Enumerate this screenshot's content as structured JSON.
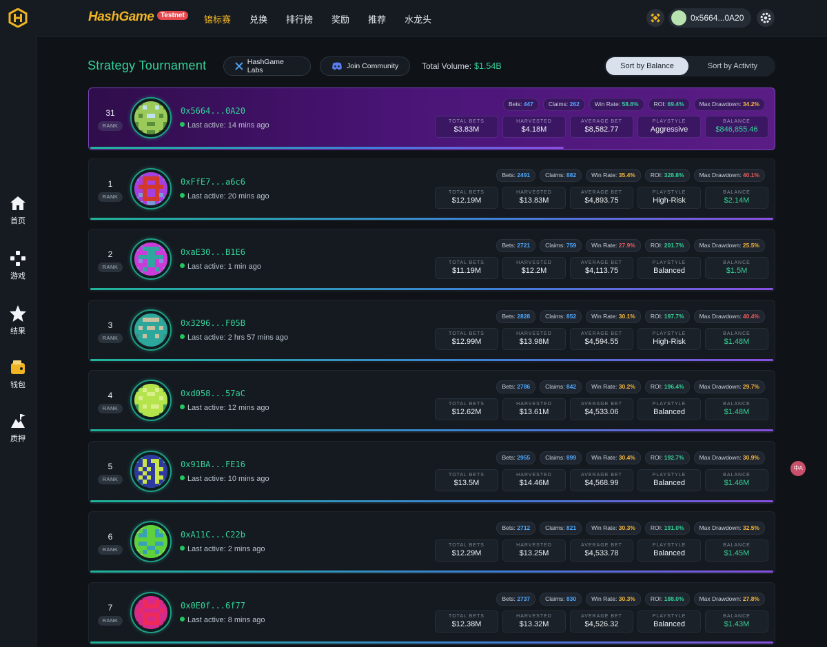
{
  "header": {
    "brand": "HashGame",
    "badge": "Testnet",
    "nav": [
      "锦标赛",
      "兑换",
      "排行榜",
      "奖励",
      "推荐",
      "水龙头"
    ],
    "active_nav": 0,
    "wallet_address": "0x5664...0A20"
  },
  "sidebar": {
    "items": [
      {
        "label": "首页",
        "icon": "home-icon"
      },
      {
        "label": "游戏",
        "icon": "gamepad-icon"
      },
      {
        "label": "结果",
        "icon": "star-icon"
      },
      {
        "label": "钱包",
        "icon": "wallet-icon"
      },
      {
        "label": "质押",
        "icon": "stake-icon"
      }
    ]
  },
  "toolbar": {
    "title": "Strategy Tournament",
    "labs_button": "HashGame Labs",
    "community_button": "Join Community",
    "volume_label": "Total Volume:",
    "volume_value": "$1.54B",
    "sort_balance": "Sort by Balance",
    "sort_activity": "Sort by Activity"
  },
  "labels": {
    "rank": "RANK",
    "bets": "Bets:",
    "claims": "Claims:",
    "win_rate": "Win Rate:",
    "roi": "ROI:",
    "max_drawdown": "Max Drawdown:",
    "total_bets": "TOTAL BETS",
    "harvested": "HARVESTED",
    "average_bet": "AVERAGE BET",
    "playstyle": "PLAYSTYLE",
    "balance": "BALANCE"
  },
  "rows": [
    {
      "rank": "31",
      "address": "0x5664...0A20",
      "active": "Last active: 14 mins ago",
      "bets": "447",
      "claims": "262",
      "win_rate": "58.6%",
      "roi": "69.4%",
      "max_drawdown": "34.2%",
      "total_bets": "$3.83M",
      "harvested": "$4.18M",
      "average_bet": "$8,582.77",
      "playstyle": "Aggressive",
      "balance": "$846,855.46",
      "me": true,
      "win_color": "green",
      "dd_color": "orange",
      "progress": 0.69
    },
    {
      "rank": "1",
      "address": "0xFfE7...a6c6",
      "active": "Last active: 20 mins ago",
      "bets": "2491",
      "claims": "882",
      "win_rate": "35.4%",
      "roi": "328.8%",
      "max_drawdown": "40.1%",
      "total_bets": "$12.19M",
      "harvested": "$13.83M",
      "average_bet": "$4,893.75",
      "playstyle": "High-Risk",
      "balance": "$2.14M",
      "win_color": "orange",
      "dd_color": "red"
    },
    {
      "rank": "2",
      "address": "0xaE30...B1E6",
      "active": "Last active: 1 min ago",
      "bets": "2721",
      "claims": "759",
      "win_rate": "27.9%",
      "roi": "201.7%",
      "max_drawdown": "25.5%",
      "total_bets": "$11.19M",
      "harvested": "$12.2M",
      "average_bet": "$4,113.75",
      "playstyle": "Balanced",
      "balance": "$1.5M",
      "win_color": "red",
      "dd_color": "orange"
    },
    {
      "rank": "3",
      "address": "0x3296...F05B",
      "active": "Last active: 2 hrs 57 mins ago",
      "bets": "2828",
      "claims": "852",
      "win_rate": "30.1%",
      "roi": "197.7%",
      "max_drawdown": "40.4%",
      "total_bets": "$12.99M",
      "harvested": "$13.98M",
      "average_bet": "$4,594.55",
      "playstyle": "High-Risk",
      "balance": "$1.48M",
      "win_color": "orange",
      "dd_color": "red"
    },
    {
      "rank": "4",
      "address": "0xd058...57aC",
      "active": "Last active: 12 mins ago",
      "bets": "2786",
      "claims": "842",
      "win_rate": "30.2%",
      "roi": "196.4%",
      "max_drawdown": "29.7%",
      "total_bets": "$12.62M",
      "harvested": "$13.61M",
      "average_bet": "$4,533.06",
      "playstyle": "Balanced",
      "balance": "$1.48M",
      "win_color": "orange",
      "dd_color": "orange"
    },
    {
      "rank": "5",
      "address": "0x91BA...FE16",
      "active": "Last active: 10 mins ago",
      "bets": "2955",
      "claims": "899",
      "win_rate": "30.4%",
      "roi": "192.7%",
      "max_drawdown": "30.9%",
      "total_bets": "$13.5M",
      "harvested": "$14.46M",
      "average_bet": "$4,568.99",
      "playstyle": "Balanced",
      "balance": "$1.46M",
      "win_color": "orange",
      "dd_color": "orange"
    },
    {
      "rank": "6",
      "address": "0xA11C...C22b",
      "active": "Last active: 2 mins ago",
      "bets": "2712",
      "claims": "821",
      "win_rate": "30.3%",
      "roi": "191.0%",
      "max_drawdown": "32.5%",
      "total_bets": "$12.29M",
      "harvested": "$13.25M",
      "average_bet": "$4,533.78",
      "playstyle": "Balanced",
      "balance": "$1.45M",
      "win_color": "orange",
      "dd_color": "orange"
    },
    {
      "rank": "7",
      "address": "0x0E0f...6f77",
      "active": "Last active: 8 mins ago",
      "bets": "2737",
      "claims": "830",
      "win_rate": "30.3%",
      "roi": "188.0%",
      "max_drawdown": "27.8%",
      "total_bets": "$12.38M",
      "harvested": "$13.32M",
      "average_bet": "$4,526.32",
      "playstyle": "Balanced",
      "balance": "$1.43M",
      "win_color": "orange",
      "dd_color": "orange"
    }
  ],
  "avatars": [
    {
      "bg": "#9bc95a",
      "fg": "#bfe0ef",
      "ac": "#5a8f3a"
    },
    {
      "bg": "#a73ee0",
      "fg": "#d2392a",
      "ac": "#7a9ad8"
    },
    {
      "bg": "#cc3ad9",
      "fg": "#2fa7a0",
      "ac": "#8a8ae0"
    },
    {
      "bg": "#2da79c",
      "fg": "#c9c0a0",
      "ac": "#3a9088"
    },
    {
      "bg": "#b4e34b",
      "fg": "#d8ef8a",
      "ac": "#3a9a5a"
    },
    {
      "bg": "#2f3aa0",
      "fg": "#c9e34b",
      "ac": "#26a87a"
    },
    {
      "bg": "#5fd13c",
      "fg": "#3aa0b8",
      "ac": "#a9e35f"
    },
    {
      "bg": "#d62a8a",
      "fg": "#ee2a5a",
      "ac": "#9a2060"
    }
  ],
  "translate_fab": "中A"
}
